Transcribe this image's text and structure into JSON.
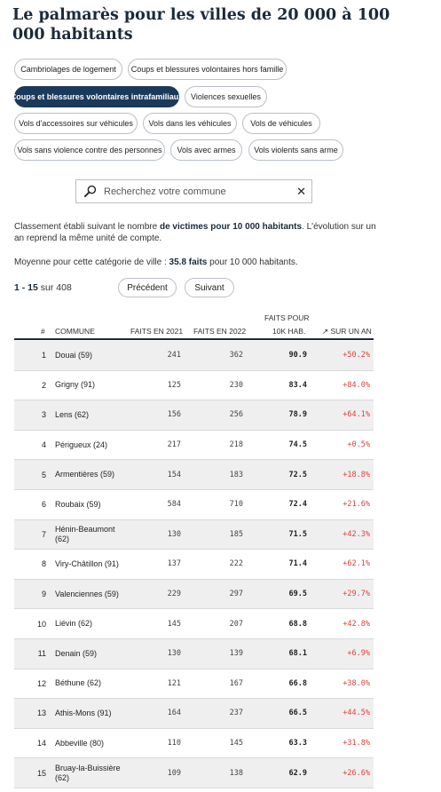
{
  "title": "Le palmarès pour les villes de 20 000 à 100 000 habitants",
  "filters": [
    {
      "label": "Cambriolages de logement",
      "active": false
    },
    {
      "label": "Coups et blessures volontaires hors famille",
      "active": false
    },
    {
      "label": "Coups et blessures volontaires intrafamiliaux",
      "active": true
    },
    {
      "label": "Violences sexuelles",
      "active": false
    },
    {
      "label": "Vols d'accessoires sur véhicules",
      "active": false
    },
    {
      "label": "Vols dans les véhicules",
      "active": false
    },
    {
      "label": "Vols de véhicules",
      "active": false
    },
    {
      "label": "Vols sans violence contre des personnes",
      "active": false
    },
    {
      "label": "Vols avec armes",
      "active": false
    },
    {
      "label": "Vols violents sans arme",
      "active": false
    }
  ],
  "search": {
    "placeholder": "Recherchez votre commune",
    "value": ""
  },
  "info": {
    "classement_1": "Classement établi suivant le nombre ",
    "classement_bold": "de victimes pour 10 000 habitants",
    "classement_2": ". L'évolution sur un an reprend la même unité de compte.",
    "moyenne_1": "Moyenne pour cette catégorie de ville : ",
    "moyenne_value": "35.8",
    "moyenne_faits": " faits",
    "moyenne_2": " pour 10 000 habitants."
  },
  "pager": {
    "range": "1 - 15",
    "of_label": " sur ",
    "total": "408",
    "prev_label": "Précédent",
    "next_label": "Suivant"
  },
  "table": {
    "headers": {
      "rank": "#",
      "commune": "COMMUNE",
      "faits_2021": "FAITS EN 2021",
      "faits_2022": "FAITS EN 2022",
      "faits_10k_1": "FAITS POUR",
      "faits_10k_2": "10K HAB.",
      "evolution": "↗ SUR UN AN"
    },
    "rows": [
      {
        "rank": "1",
        "commune": "Douai (59)",
        "f2021": "241",
        "f2022": "362",
        "per10k": "90.9",
        "evol": "+50.2%"
      },
      {
        "rank": "2",
        "commune": "Grigny (91)",
        "f2021": "125",
        "f2022": "230",
        "per10k": "83.4",
        "evol": "+84.0%"
      },
      {
        "rank": "3",
        "commune": "Lens (62)",
        "f2021": "156",
        "f2022": "256",
        "per10k": "78.9",
        "evol": "+64.1%"
      },
      {
        "rank": "4",
        "commune": "Périgueux (24)",
        "f2021": "217",
        "f2022": "218",
        "per10k": "74.5",
        "evol": "+0.5%"
      },
      {
        "rank": "5",
        "commune": "Armentières (59)",
        "f2021": "154",
        "f2022": "183",
        "per10k": "72.5",
        "evol": "+18.8%"
      },
      {
        "rank": "6",
        "commune": "Roubaix (59)",
        "f2021": "584",
        "f2022": "710",
        "per10k": "72.4",
        "evol": "+21.6%"
      },
      {
        "rank": "7",
        "commune": "Hénin-Beaumont (62)",
        "f2021": "130",
        "f2022": "185",
        "per10k": "71.5",
        "evol": "+42.3%"
      },
      {
        "rank": "8",
        "commune": "Viry-Châtillon (91)",
        "f2021": "137",
        "f2022": "222",
        "per10k": "71.4",
        "evol": "+62.1%"
      },
      {
        "rank": "9",
        "commune": "Valenciennes (59)",
        "f2021": "229",
        "f2022": "297",
        "per10k": "69.5",
        "evol": "+29.7%"
      },
      {
        "rank": "10",
        "commune": "Liévin (62)",
        "f2021": "145",
        "f2022": "207",
        "per10k": "68.8",
        "evol": "+42.8%"
      },
      {
        "rank": "11",
        "commune": "Denain (59)",
        "f2021": "130",
        "f2022": "139",
        "per10k": "68.1",
        "evol": "+6.9%"
      },
      {
        "rank": "12",
        "commune": "Béthune (62)",
        "f2021": "121",
        "f2022": "167",
        "per10k": "66.8",
        "evol": "+38.0%"
      },
      {
        "rank": "13",
        "commune": "Athis-Mons (91)",
        "f2021": "164",
        "f2022": "237",
        "per10k": "66.5",
        "evol": "+44.5%"
      },
      {
        "rank": "14",
        "commune": "Abbeville (80)",
        "f2021": "110",
        "f2022": "145",
        "per10k": "63.3",
        "evol": "+31.8%"
      },
      {
        "rank": "15",
        "commune": "Bruay-la-Buissière (62)",
        "f2021": "109",
        "f2022": "138",
        "per10k": "62.9",
        "evol": "+26.6%"
      }
    ]
  },
  "colors": {
    "accent": "#1b3a5b",
    "increase": "#e0413b"
  },
  "icons": {
    "search": "magnifier-icon",
    "clear": "close-icon"
  }
}
